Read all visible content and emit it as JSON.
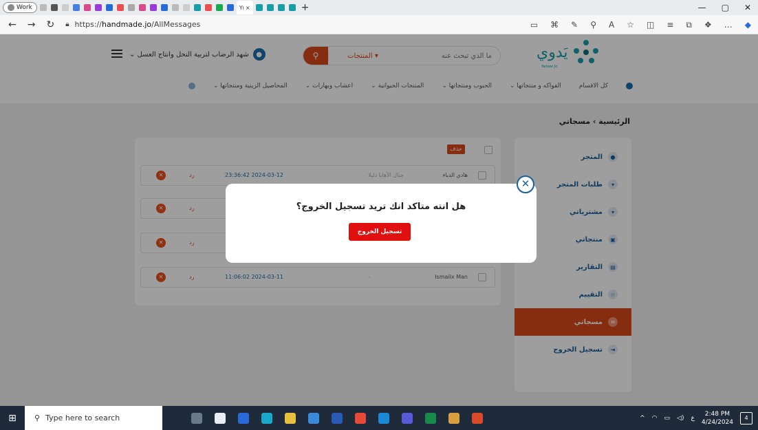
{
  "browser": {
    "profile_label": "Work",
    "active_tab_label": "Yı",
    "url_prefix": "https://",
    "url_host": "handmade.jo",
    "url_path": "/AllMessages"
  },
  "site": {
    "logo_text": "يَدوي",
    "logo_sub": "Yadawi Jo",
    "search": {
      "placeholder": "ما الذي تبحث عنه",
      "category": "المنتجات ▾"
    },
    "user_name": "شهد الرضاب لتربية النحل وانتاج العسل ⌄",
    "categories": [
      "كل الاقسام",
      "الفواكه و منتجاتها ⌄",
      "الحبوب ومنتجاتها ⌄",
      "المنتجات الحيوانية ⌄",
      "اعشاب وبهارات ⌄",
      "المحاصيل الزينية ومنتجاتها ⌄"
    ]
  },
  "breadcrumb": "الرئيسية › مسجاتي",
  "sidebar": {
    "items": [
      {
        "label": "المتجر"
      },
      {
        "label": "طلبات المتجر"
      },
      {
        "label": "مشترياتي"
      },
      {
        "label": "منتجاتي"
      },
      {
        "label": "التقارير"
      },
      {
        "label": "التقييم"
      },
      {
        "label": "مسجاتي"
      },
      {
        "label": "تسجيل الخروج"
      }
    ]
  },
  "messages": {
    "delete_label": "حذف",
    "rows": [
      {
        "reply": "رد",
        "date": "23:36:42 2024-03-12",
        "subject": "جبال الأهايا دليلا",
        "from": "هادي الدباء"
      },
      {
        "reply": "رد",
        "date": "",
        "subject": "",
        "from": ""
      },
      {
        "reply": "رد",
        "date": "",
        "subject": "",
        "from": ""
      },
      {
        "reply": "رد",
        "date": "11:06:02 2024-03-11",
        "subject": "-",
        "from": "Ismailx Man"
      }
    ]
  },
  "modal": {
    "question": "هل انته متاكد انك تريد تسجيل الخروج؟",
    "confirm_label": "تسجيل الخروج"
  },
  "taskbar": {
    "search_placeholder": "Type here to search",
    "time": "2:48 PM",
    "date": "4/24/2024",
    "lang": "ع",
    "notif_count": "4"
  }
}
